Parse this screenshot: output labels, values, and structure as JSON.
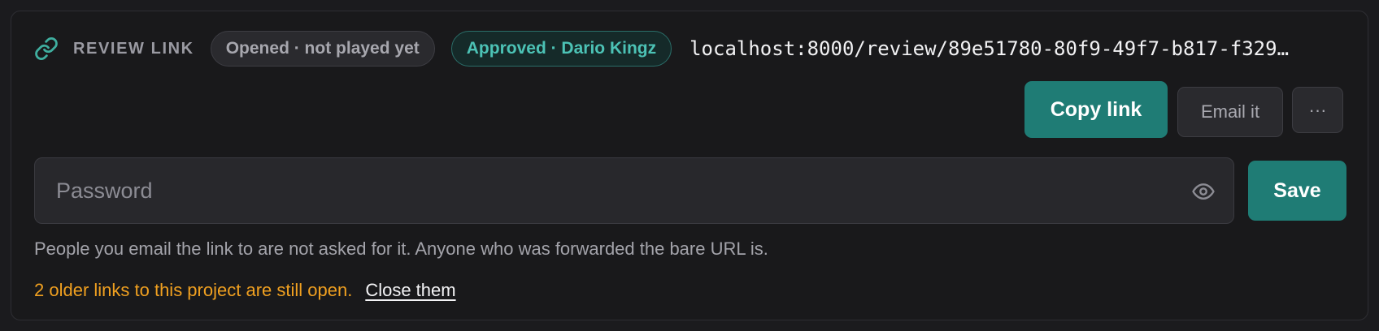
{
  "review_link": {
    "icon": "link-icon",
    "label": "REVIEW LINK",
    "status_opened": "Opened · not played yet",
    "status_approved": "Approved · Dario Kingz",
    "url": "localhost:8000/review/89e51780-80f9-49f7-b817-f329…"
  },
  "actions": {
    "copy_label": "Copy link",
    "email_label": "Email it",
    "more_label": "···"
  },
  "password": {
    "placeholder": "Password",
    "value": "",
    "toggle_icon": "eye-icon",
    "save_label": "Save",
    "hint": "People you email the link to are not asked for it. Anyone who was forwarded the bare URL is."
  },
  "older_links": {
    "message": "2 older links to this project are still open.",
    "close_label": "Close them"
  },
  "colors": {
    "accent": "#1f7c75",
    "approved_text": "#4cc2b5",
    "warning": "#f0a020",
    "background": "#19191b"
  }
}
